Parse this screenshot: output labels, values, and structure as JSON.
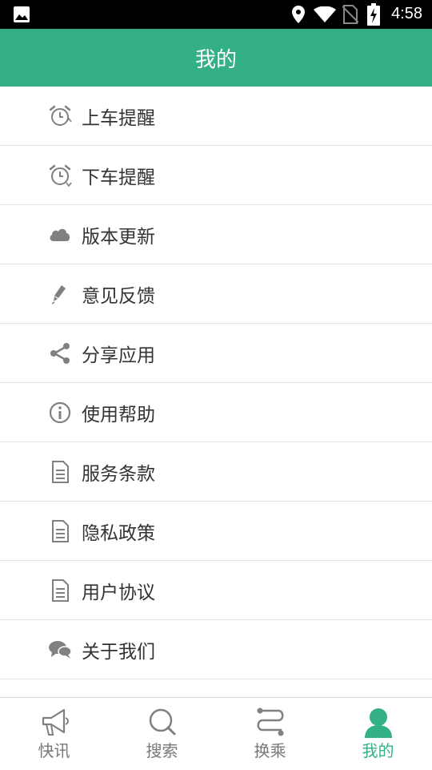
{
  "status_bar": {
    "time": "4:58",
    "icons": [
      "image-icon",
      "location-icon",
      "wifi-icon",
      "no-sim-icon",
      "battery-charging-icon"
    ]
  },
  "header": {
    "title": "我的"
  },
  "menu": [
    {
      "label": "上车提醒",
      "icon": "alarm-icon"
    },
    {
      "label": "下车提醒",
      "icon": "alarm-icon"
    },
    {
      "label": "版本更新",
      "icon": "cloud-icon"
    },
    {
      "label": "意见反馈",
      "icon": "pencil-icon"
    },
    {
      "label": "分享应用",
      "icon": "share-icon"
    },
    {
      "label": "使用帮助",
      "icon": "info-icon"
    },
    {
      "label": "服务条款",
      "icon": "document-icon"
    },
    {
      "label": "隐私政策",
      "icon": "document-icon"
    },
    {
      "label": "用户协议",
      "icon": "document-icon"
    },
    {
      "label": "关于我们",
      "icon": "chat-icon"
    }
  ],
  "tabs": [
    {
      "label": "快讯",
      "icon": "megaphone-icon",
      "active": false
    },
    {
      "label": "搜索",
      "icon": "search-icon",
      "active": false
    },
    {
      "label": "换乘",
      "icon": "route-icon",
      "active": false
    },
    {
      "label": "我的",
      "icon": "person-icon",
      "active": true
    }
  ],
  "colors": {
    "accent": "#34b086",
    "icon_gray": "#808080",
    "text": "#333333"
  }
}
